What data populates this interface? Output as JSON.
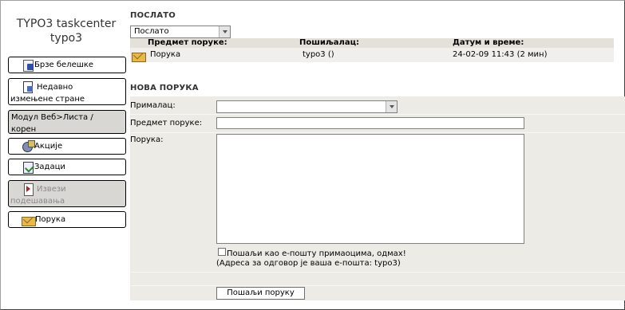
{
  "sidebar": {
    "title_line1": "TYPO3 taskcenter",
    "title_line2": "typo3",
    "items": [
      {
        "label": "Брзе белешке",
        "icon": "note-icon"
      },
      {
        "label_line1": "Недавно",
        "label_line2": "измењене стране",
        "icon": "page-icon"
      },
      {
        "label_line1": "Модул Веб>Листа /",
        "label_line2": "корен"
      },
      {
        "label": "Акције",
        "icon": "gear-icon"
      },
      {
        "label": "Задаци",
        "icon": "task-icon"
      },
      {
        "label_line1": "Извези",
        "label_line2": "подешавања",
        "icon": "export-icon"
      },
      {
        "label": "Порука",
        "icon": "mail-icon"
      }
    ]
  },
  "sent": {
    "title": "ПОСЛАТО",
    "filter_value": "Послато",
    "columns": [
      "Предмет поруке:",
      "Пошиљалац:",
      "Датум и време:"
    ],
    "rows": [
      {
        "subject": "Порука",
        "sender": "typo3 ()",
        "datetime": "24-02-09 11:43 (2 мин)"
      }
    ]
  },
  "new_message": {
    "title": "НОВА ПОРУКА",
    "recipient_label": "Прималац:",
    "recipient_value": "",
    "subject_label": "Предмет поруке:",
    "subject_value": "",
    "message_label": "Порука:",
    "message_value": "",
    "email_checkbox_label": "Пошаљи као е-пошту примаоцима, одмах!",
    "reply_note": "(Адреса за одговор је ваша е-пошта: typo3)",
    "send_button": "Пошаљи поруку"
  },
  "colors": {
    "form_bg": "#edebe6",
    "table_head_bg": "#e4e1da",
    "row_bg": "#f1efec",
    "active_button_bg": "#d8d7d3"
  }
}
